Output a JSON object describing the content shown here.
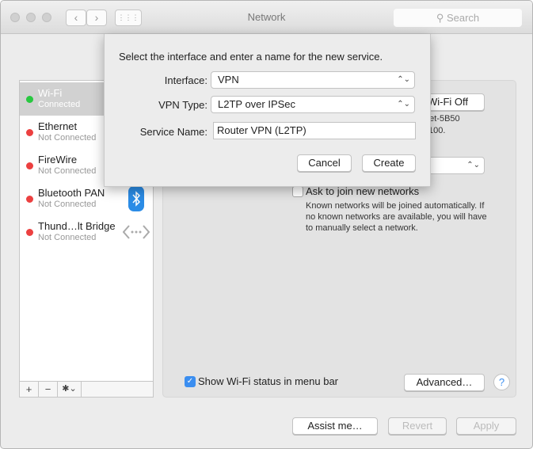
{
  "window": {
    "title": "Network",
    "search_placeholder": "Search",
    "back": "‹",
    "forward": "›",
    "grid": "⋮⋮⋮"
  },
  "services": [
    {
      "name": "Wi-Fi",
      "status": "Connected",
      "color": "#28c840",
      "selected": true
    },
    {
      "name": "Ethernet",
      "status": "Not Connected",
      "color": "#ec4040"
    },
    {
      "name": "FireWire",
      "status": "Not Connected",
      "color": "#ec4040"
    },
    {
      "name": "Bluetooth PAN",
      "status": "Not Connected",
      "color": "#ec4040",
      "icon": "bluetooth-icon"
    },
    {
      "name": "Thund…lt Bridge",
      "status": "Not Connected",
      "color": "#ec4040",
      "icon": "thunderbolt-bridge-icon"
    }
  ],
  "sidebar_toolbar": {
    "add": "+",
    "remove": "−",
    "gear": "✱⌄"
  },
  "panel": {
    "wifi_off_button": "Wi-Fi Off",
    "network_info_1": "net-5B50",
    "network_info_2": ".100.",
    "ask_to_join": "Ask to join new networks",
    "ask_to_join_checked": false,
    "ask_help": "Known networks will be joined automatically. If no known networks are available, you will have to manually select a network.",
    "show_status": "Show Wi-Fi status in menu bar",
    "show_status_checked": true,
    "advanced": "Advanced…",
    "help": "?"
  },
  "footer": {
    "assist": "Assist me…",
    "revert": "Revert",
    "apply": "Apply"
  },
  "sheet": {
    "prompt": "Select the interface and enter a name for the new service.",
    "interface_label": "Interface:",
    "interface_value": "VPN",
    "vpn_type_label": "VPN Type:",
    "vpn_type_value": "L2TP over IPSec",
    "service_name_label": "Service Name:",
    "service_name_value": "Router VPN (L2TP)",
    "cancel": "Cancel",
    "create": "Create"
  },
  "accent": "#3b8ef0"
}
